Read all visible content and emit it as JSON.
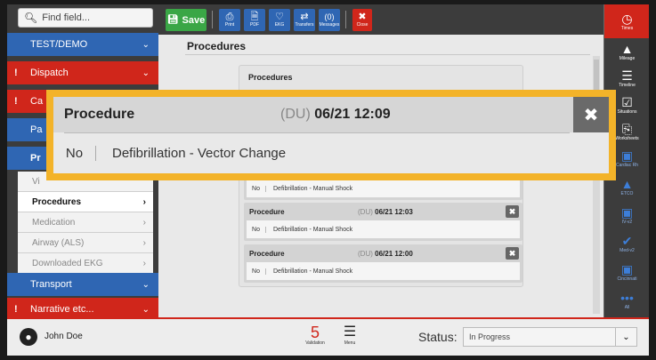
{
  "search": {
    "placeholder": "Find field..."
  },
  "sidebar": {
    "sections": [
      {
        "label": "TEST/DEMO",
        "alert": false
      },
      {
        "label": "Dispatch",
        "alert": true,
        "bang": "!"
      },
      {
        "label": "Ca",
        "alert": true,
        "bang": "!"
      },
      {
        "label": "Pa",
        "alert": false
      },
      {
        "label": "Pr",
        "alert": false
      }
    ],
    "subitems": [
      {
        "label": "Vi"
      },
      {
        "label": "Procedures"
      },
      {
        "label": "Medication"
      },
      {
        "label": "Airway (ALS)"
      },
      {
        "label": "Downloaded EKG"
      }
    ],
    "bottom_sections": [
      {
        "label": "Transport",
        "alert": false
      },
      {
        "label": "Narrative etc...",
        "alert": true,
        "bang": "!"
      }
    ]
  },
  "toolbar": {
    "save_label": "Save",
    "print_label": "Print",
    "pdf_label": "PDF",
    "ekg_label": "EKG",
    "transfers_label": "Transfers",
    "messages_label": "Messages",
    "messages_count": "(0)",
    "close_label": "Close"
  },
  "main": {
    "title": "Procedures",
    "panel_title": "Procedures",
    "cards": [
      {
        "no": "No",
        "desc": "Defibrillation - Manual Shock"
      },
      {
        "title": "Procedure",
        "du": "(DU)",
        "datetime": "06/21 12:03",
        "no": "No",
        "desc": "Defibrillation - Manual Shock"
      },
      {
        "title": "Procedure",
        "du": "(DU)",
        "datetime": "06/21 12:00",
        "no": "No",
        "desc": "Defibrillation - Manual Shock"
      }
    ]
  },
  "zoom": {
    "title": "Procedure",
    "du": "(DU)",
    "datetime": "06/21 12:09",
    "no": "No",
    "desc": "Defibrillation - Vector Change"
  },
  "rail": {
    "times_bang": "!",
    "items": [
      {
        "label": "Times",
        "icon": "clock-icon"
      },
      {
        "label": "Mileage",
        "icon": "road-icon"
      },
      {
        "label": "Timeline",
        "icon": "sliders-icon"
      },
      {
        "label": "Situations",
        "icon": "checklist-icon"
      },
      {
        "label": "Worksheets",
        "icon": "copy-icon"
      },
      {
        "label": "Cardiac Rh",
        "icon": "monitor-icon"
      },
      {
        "label": "ETCO",
        "icon": "lungs-icon"
      },
      {
        "label": "IV-v2",
        "icon": "monitor-icon"
      },
      {
        "label": "Med-v2",
        "icon": "syringe-icon"
      },
      {
        "label": "Cincinnati",
        "icon": "monitor-icon"
      },
      {
        "label": "All",
        "icon": "more-icon"
      }
    ]
  },
  "bottom": {
    "user": "John Doe",
    "validation_count": "5",
    "validation_label": "Validation",
    "menu_label": "Menu",
    "status_label": "Status:",
    "status_value": "In Progress"
  }
}
